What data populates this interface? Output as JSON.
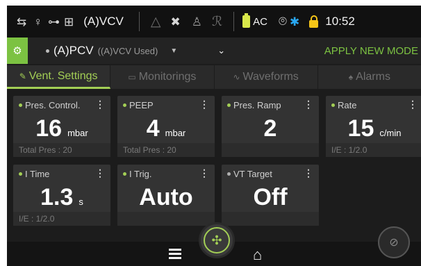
{
  "status": {
    "mode": "(A)VCV",
    "power": "AC",
    "time": "10:52",
    "icons": [
      "network-icon",
      "patient-icon",
      "circuit-icon",
      "ventilator-icon",
      "warning-triangle-icon",
      "tools-icon",
      "patient-dim-icon",
      "mask-icon",
      "battery-icon",
      "wifi-icon",
      "bluetooth-icon",
      "lock-icon"
    ]
  },
  "modebar": {
    "mode_name": "(A)PCV",
    "mode_used": "((A)VCV Used)",
    "apply_label": "APPLY NEW MODE"
  },
  "tabs": [
    {
      "label": "Vent. Settings",
      "icon": "wrench-icon",
      "active": true
    },
    {
      "label": "Monitorings",
      "icon": "monitor-icon",
      "active": false
    },
    {
      "label": "Waveforms",
      "icon": "wave-icon",
      "active": false
    },
    {
      "label": "Alarms",
      "icon": "bell-icon",
      "active": false
    }
  ],
  "tiles": [
    {
      "title": "Pres. Control.",
      "value": "16",
      "unit": "mbar",
      "footer": "Total Pres : 20"
    },
    {
      "title": "PEEP",
      "value": "4",
      "unit": "mbar",
      "footer": "Total Pres : 20"
    },
    {
      "title": "Pres. Ramp",
      "value": "2",
      "unit": "",
      "footer": ""
    },
    {
      "title": "Rate",
      "value": "15",
      "unit": "c/min",
      "footer": "I/E : 1/2.0"
    },
    {
      "title": "I Time",
      "value": "1.3",
      "unit": "s",
      "footer": "I/E : 1/2.0"
    },
    {
      "title": "I Trig.",
      "value": "Auto",
      "unit": "",
      "footer": ""
    },
    {
      "title": "VT Target",
      "value": "Off",
      "unit": "",
      "footer": ""
    }
  ],
  "colors": {
    "accent": "#a3cf55",
    "brand_green": "#7cc242",
    "lock": "#f5c518"
  }
}
